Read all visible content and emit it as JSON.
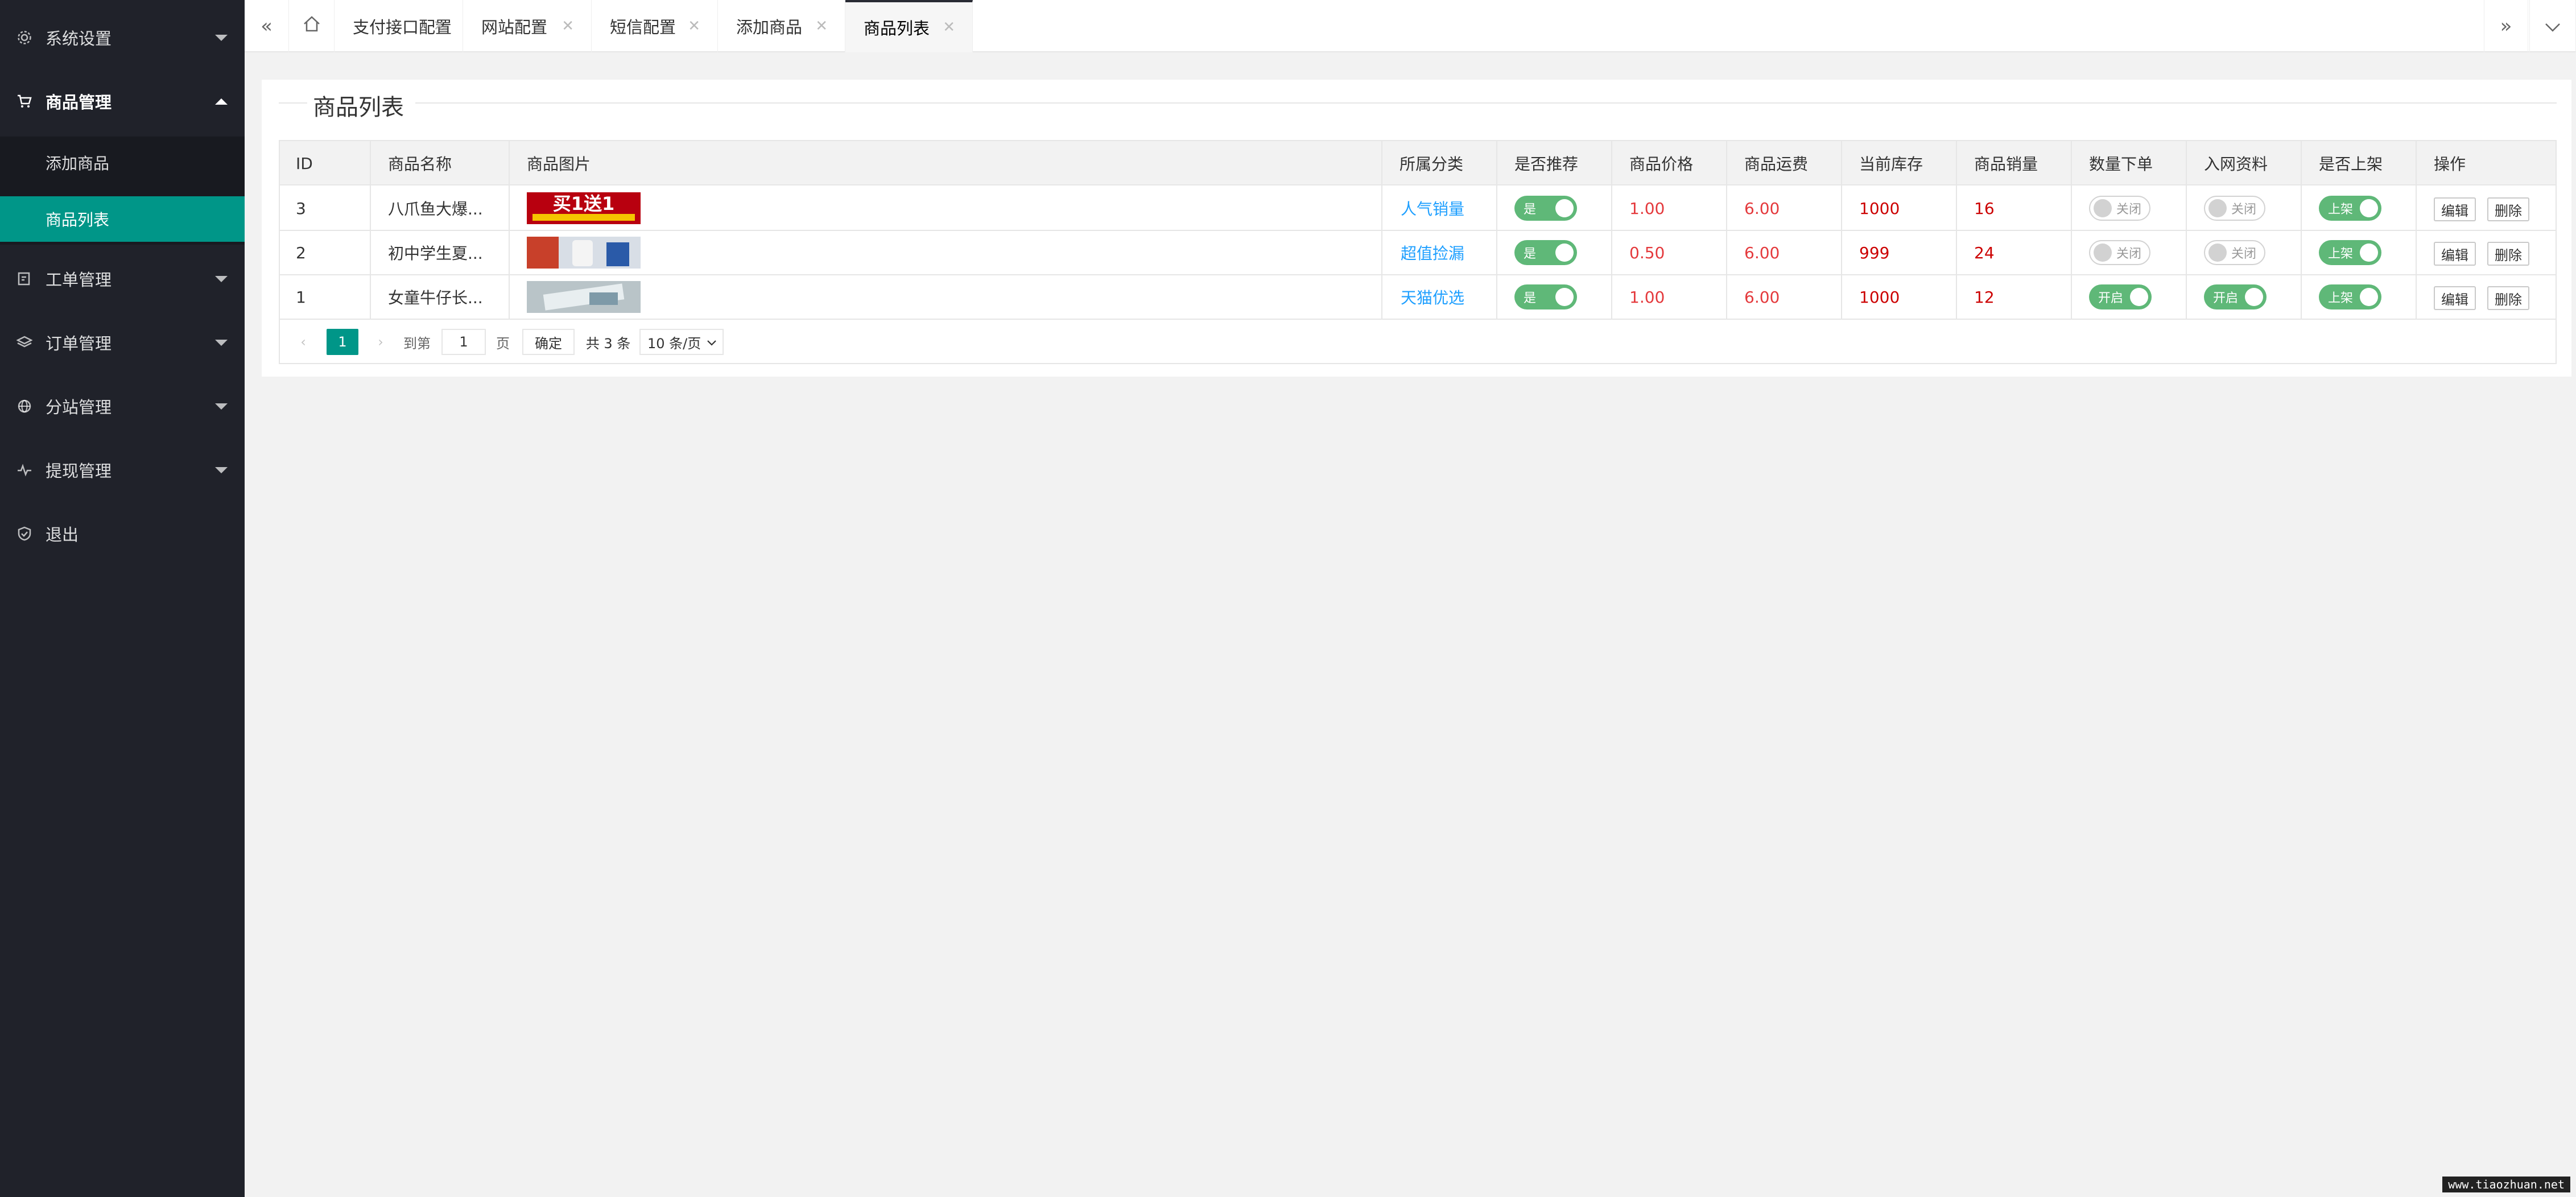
{
  "sidebar": {
    "items": [
      {
        "label": "系统设置",
        "icon": "gear-icon"
      },
      {
        "label": "商品管理",
        "icon": "cart-icon"
      },
      {
        "label": "工单管理",
        "icon": "ticket-icon"
      },
      {
        "label": "订单管理",
        "icon": "layers-icon"
      },
      {
        "label": "分站管理",
        "icon": "globe-icon"
      },
      {
        "label": "提现管理",
        "icon": "pulse-icon"
      },
      {
        "label": "退出",
        "icon": "shield-icon"
      }
    ],
    "sub_items": [
      {
        "label": "添加商品"
      },
      {
        "label": "商品列表"
      }
    ]
  },
  "tabs": [
    {
      "label": "支付接口配置"
    },
    {
      "label": "网站配置"
    },
    {
      "label": "短信配置"
    },
    {
      "label": "添加商品"
    },
    {
      "label": "商品列表"
    }
  ],
  "page": {
    "title": "商品列表"
  },
  "table": {
    "headers": [
      "ID",
      "商品名称",
      "商品图片",
      "所属分类",
      "是否推荐",
      "商品价格",
      "商品运费",
      "当前库存",
      "商品销量",
      "数量下单",
      "入网资料",
      "是否上架",
      "操作"
    ],
    "rows": [
      {
        "id": "3",
        "name": "八爪鱼大爆...",
        "category": "人气销量",
        "recommend": "是",
        "price": "1.00",
        "freight": "6.00",
        "stock": "1000",
        "sales": "16",
        "qty_order": "关闭",
        "net_info": "关闭",
        "on_shelf": "上架",
        "image_text": "买1送1"
      },
      {
        "id": "2",
        "name": "初中学生夏...",
        "category": "超值捡漏",
        "recommend": "是",
        "price": "0.50",
        "freight": "6.00",
        "stock": "999",
        "sales": "24",
        "qty_order": "关闭",
        "net_info": "关闭",
        "on_shelf": "上架"
      },
      {
        "id": "1",
        "name": "女童牛仔长...",
        "category": "天猫优选",
        "recommend": "是",
        "price": "1.00",
        "freight": "6.00",
        "stock": "1000",
        "sales": "12",
        "qty_order": "开启",
        "net_info": "开启",
        "on_shelf": "上架"
      }
    ],
    "actions": {
      "edit": "编辑",
      "delete": "删除"
    }
  },
  "pager": {
    "current": "1",
    "goto_label": "到第",
    "page_input": "1",
    "page_unit": "页",
    "confirm": "确定",
    "total": "共 3 条",
    "page_size": "10 条/页"
  },
  "watermark": "www.tiaozhuan.net",
  "colors": {
    "sidebar": "#20222a",
    "accent": "#009688",
    "switch_on": "#5fb878",
    "category": "#1e9fff",
    "price": "#e4393c"
  }
}
